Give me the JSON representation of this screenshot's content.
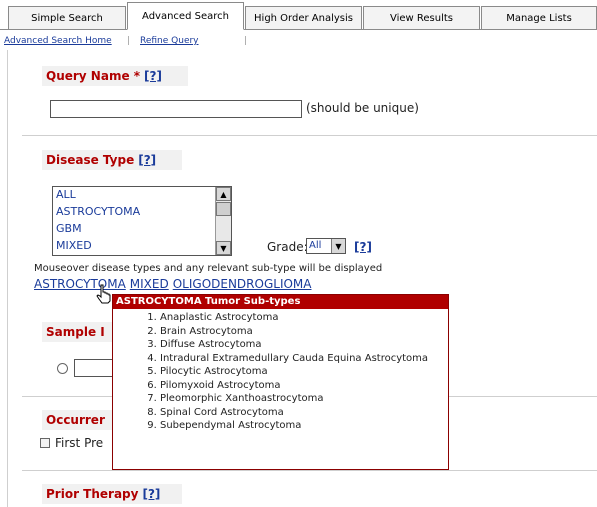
{
  "tabs": [
    {
      "label": "Simple Search"
    },
    {
      "label": "Advanced Search"
    },
    {
      "label": "High Order Analysis"
    },
    {
      "label": "View Results"
    },
    {
      "label": "Manage Lists"
    }
  ],
  "active_tab": "Advanced Search",
  "subnav": {
    "home": "Advanced Search Home",
    "refine": "Refine Query"
  },
  "help_label": "[?]",
  "query_name": {
    "title": "Query Name *",
    "value": "",
    "hint": "(should be unique)"
  },
  "disease_type": {
    "title": "Disease Type",
    "options": [
      "ALL",
      "ASTROCYTOMA",
      "GBM",
      "MIXED"
    ],
    "grade_label": "Grade:",
    "grade_value": "All",
    "note": "Mouseover disease types and any relevant sub-type will be displayed",
    "links": [
      "ASTROCYTOMA",
      "MIXED",
      "OLIGODENDROGLIOMA"
    ]
  },
  "popup": {
    "title": "ASTROCYTOMA Tumor Sub-types",
    "items": [
      "Anaplastic Astrocytoma",
      "Brain Astrocytoma",
      "Diffuse Astrocytoma",
      "Intradural Extramedullary Cauda Equina Astrocytoma",
      "Pilocytic Astrocytoma",
      "Pilomyxoid Astrocytoma",
      "Pleomorphic Xanthoastrocytoma",
      "Spinal Cord Astrocytoma",
      "Subependymal Astrocytoma"
    ]
  },
  "sample_section": {
    "title_visible": "Sample I"
  },
  "occurrence_section": {
    "title_visible": "Occurrer",
    "checkbox_label_visible": "First Pre"
  },
  "prior_therapy": {
    "title": "Prior Therapy"
  }
}
